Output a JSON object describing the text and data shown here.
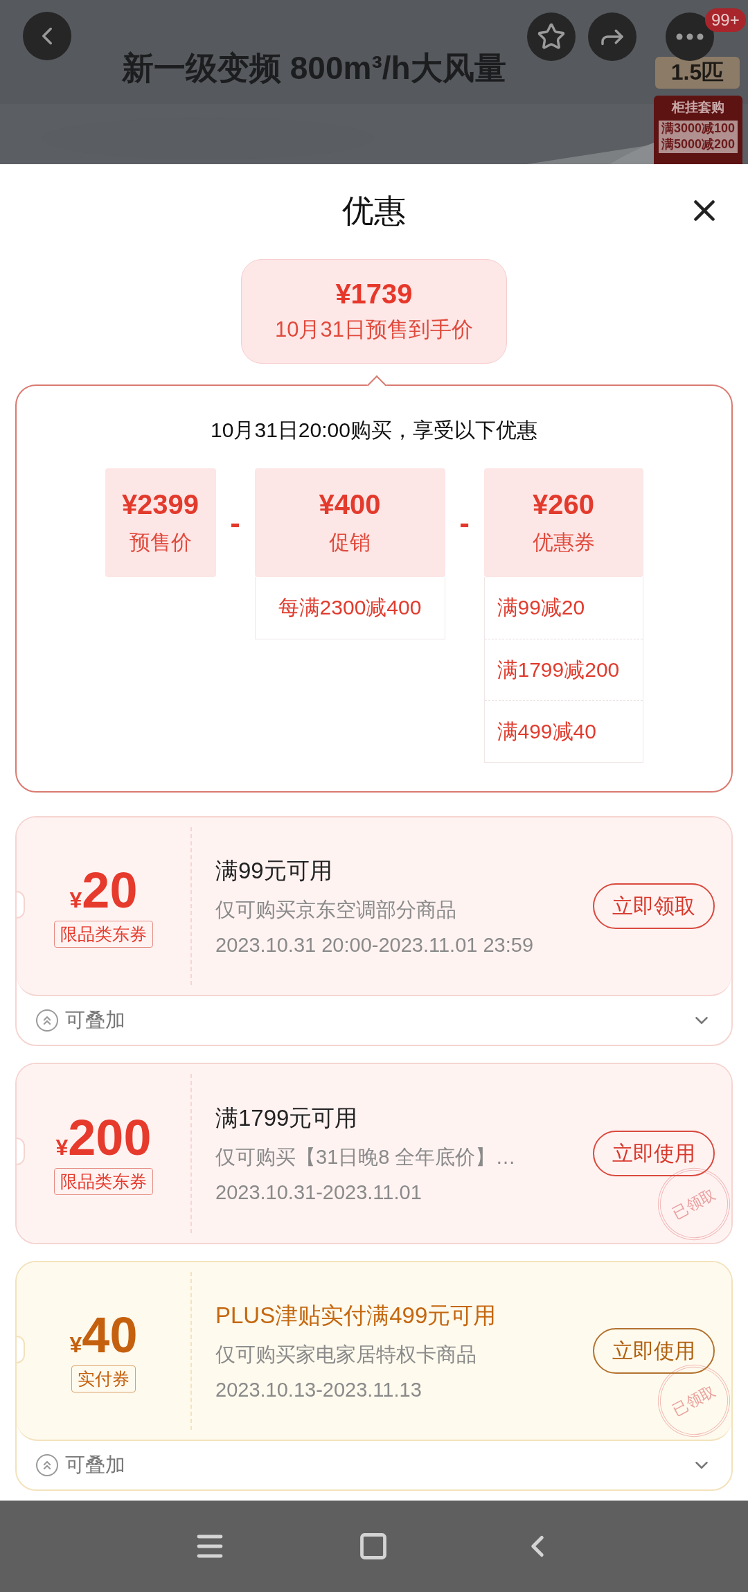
{
  "header": {
    "badge": "99+"
  },
  "banner": {
    "title": "新一级变频 800m³/h大风量",
    "size_tag": "1.5匹",
    "promo": {
      "title": "柜挂套购",
      "lines": [
        "满3000减100",
        "满5000减200"
      ]
    }
  },
  "sheet": {
    "title": "优惠"
  },
  "final_price": {
    "amount": "¥1739",
    "label": "10月31日预售到手价"
  },
  "breakdown": {
    "heading": "10月31日20:00购买，享受以下优惠",
    "items": [
      {
        "amount": "¥2399",
        "label": "预售价"
      },
      {
        "operator": "-",
        "amount": "¥400",
        "label": "促销",
        "details": [
          "每满2300减400"
        ]
      },
      {
        "operator": "-",
        "amount": "¥260",
        "label": "优惠券",
        "details": [
          "满99减20",
          "满1799减200",
          "满499减40"
        ]
      }
    ]
  },
  "coupons": [
    {
      "kind": "red",
      "symbol": "¥",
      "value": "20",
      "tag": "限品类东券",
      "title": "满99元可用",
      "desc": "仅可购买京东空调部分商品",
      "period": "2023.10.31 20:00-2023.11.01 23:59",
      "action": "立即领取",
      "footer": {
        "label": "可叠加",
        "expanded": false
      }
    },
    {
      "kind": "red",
      "symbol": "¥",
      "value": "200",
      "tag": "限品类东券",
      "title": "满1799元可用",
      "desc": "仅可购买【31日晚8 全年底价】…",
      "period": "2023.10.31-2023.11.01",
      "action": "立即使用",
      "stamp": "已领取"
    },
    {
      "kind": "gold",
      "symbol": "¥",
      "value": "40",
      "tag": "实付券",
      "title": "PLUS津贴实付满499元可用",
      "desc": "仅可购买家电家居特权卡商品",
      "period": "2023.10.13-2023.11.13",
      "action": "立即使用",
      "stamp": "已领取",
      "footer": {
        "label": "可叠加",
        "expanded": false
      }
    }
  ]
}
